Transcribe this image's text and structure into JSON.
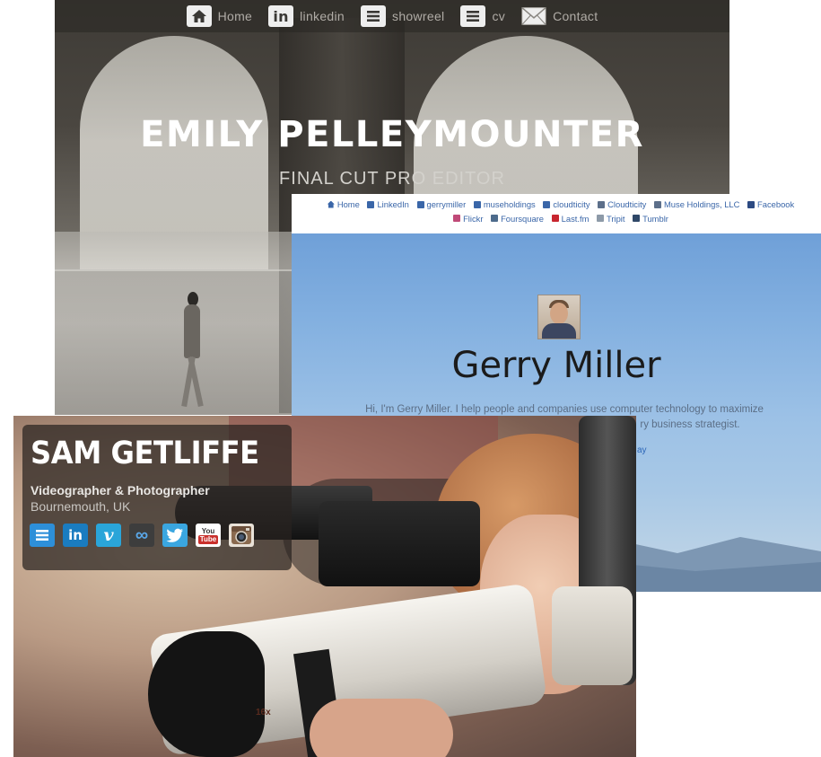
{
  "emily": {
    "nav": [
      {
        "label": "Home",
        "icon": "home-icon"
      },
      {
        "label": "linkedin",
        "icon": "linkedin-icon"
      },
      {
        "label": "showreel",
        "icon": "menu-icon"
      },
      {
        "label": "cv",
        "icon": "menu-icon"
      },
      {
        "label": "Contact",
        "icon": "envelope-icon"
      }
    ],
    "linkedin_glyph": "in",
    "title": "EMILY PELLEYMOUNTER",
    "subtitle": "FINAL CUT PRO EDITOR"
  },
  "gerry": {
    "nav_row1": [
      "Home",
      "LinkedIn",
      "gerrymiller",
      "museholdings",
      "cloudticity",
      "Cloudticity",
      "Muse Holdings, LLC",
      "Facebook"
    ],
    "nav_row2": [
      "Flickr",
      "Foursquare",
      "Last.fm",
      "Tripit",
      "Tumblr"
    ],
    "name": "Gerry Miller",
    "bio": "Hi, I'm Gerry Miller. I help people and companies use computer technology to maximize",
    "bio2": "ry business strategist.",
    "link": "ay"
  },
  "sam": {
    "title": "SAM GETLIFFE",
    "role": "Videographer & Photographer",
    "location": "Bournemouth, UK",
    "lens_label": "16x",
    "social": [
      {
        "name": "menu",
        "icon": "menu-icon",
        "color": "#2d8fd9"
      },
      {
        "name": "linkedin",
        "icon": "linkedin-icon",
        "glyph": "in",
        "color": "#1a7cc0"
      },
      {
        "name": "vimeo",
        "icon": "vimeo-icon",
        "glyph": "v",
        "color": "#2aa5d9"
      },
      {
        "name": "flickr",
        "icon": "infinity-icon",
        "glyph": "∞",
        "color": "#3d3d3d"
      },
      {
        "name": "twitter",
        "icon": "twitter-bird-icon",
        "color": "#3aa6e0"
      },
      {
        "name": "youtube",
        "icon": "youtube-icon",
        "glyph_top": "You",
        "glyph_bottom": "Tube",
        "color": "#c9302c"
      },
      {
        "name": "instagram",
        "icon": "instagram-camera-icon",
        "color": "#8a6a4f"
      }
    ]
  }
}
